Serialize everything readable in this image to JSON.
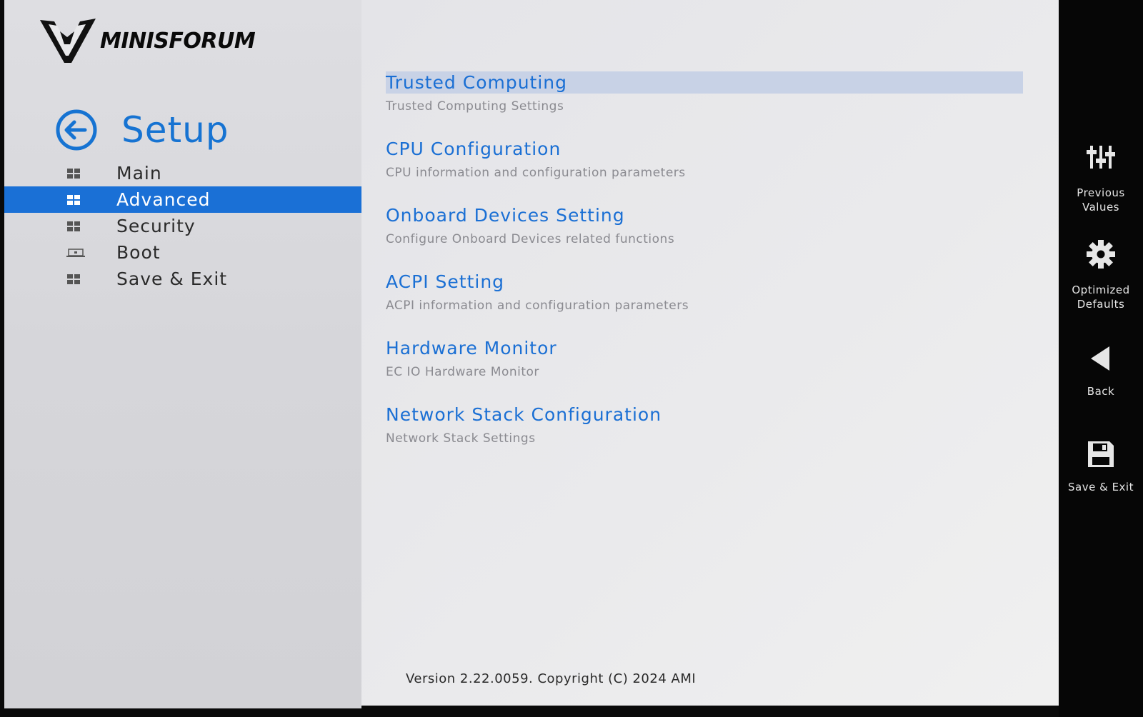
{
  "brand": {
    "logo_text": "MINISFORUM"
  },
  "page": {
    "title": "Setup"
  },
  "nav": {
    "items": [
      {
        "label": "Main",
        "icon": "grid-icon",
        "selected": false
      },
      {
        "label": "Advanced",
        "icon": "grid-icon",
        "selected": true
      },
      {
        "label": "Security",
        "icon": "grid-icon",
        "selected": false
      },
      {
        "label": "Boot",
        "icon": "laptop-icon",
        "selected": false
      },
      {
        "label": "Save & Exit",
        "icon": "grid-icon",
        "selected": false
      }
    ]
  },
  "menu": {
    "items": [
      {
        "title": "Trusted Computing",
        "description": "Trusted Computing Settings",
        "highlighted": true
      },
      {
        "title": "CPU Configuration",
        "description": "CPU information and configuration parameters",
        "highlighted": false
      },
      {
        "title": "Onboard Devices Setting",
        "description": "Configure Onboard Devices related functions",
        "highlighted": false
      },
      {
        "title": "ACPI Setting",
        "description": "ACPI information and configuration parameters",
        "highlighted": false
      },
      {
        "title": "Hardware Monitor",
        "description": "EC IO Hardware Monitor",
        "highlighted": false
      },
      {
        "title": "Network Stack Configuration",
        "description": "Network Stack Settings",
        "highlighted": false
      }
    ]
  },
  "footer": {
    "version": "Version 2.22.0059. Copyright (C) 2024 AMI"
  },
  "sidebar": {
    "previous_values": {
      "line1": "Previous",
      "line2": "Values",
      "icon": "sliders-icon"
    },
    "optimized_defaults": {
      "line1": "Optimized",
      "line2": "Defaults",
      "icon": "gear-icon"
    },
    "back": {
      "label": "Back",
      "icon": "triangle-left-icon"
    },
    "save_exit": {
      "label": "Save & Exit",
      "icon": "floppy-disk-icon"
    }
  },
  "colors": {
    "accent": "#1a70d6",
    "title_blue": "#1673d2",
    "menu_highlight": "#c8d2e6",
    "sidebar_bg": "#060606"
  }
}
